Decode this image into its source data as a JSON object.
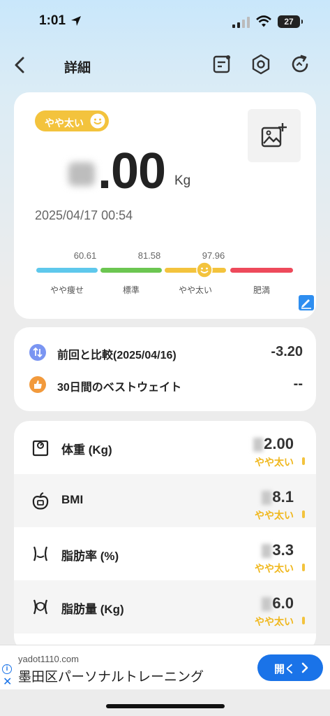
{
  "status_bar": {
    "time": "1:01",
    "battery": "27"
  },
  "nav": {
    "title": "詳細"
  },
  "summary": {
    "badge": "やや太い",
    "weight_value": ".00",
    "unit": "Kg",
    "measured_at": "2025/04/17 00:54",
    "thresholds": [
      "60.61",
      "81.58",
      "97.96"
    ],
    "categories": [
      {
        "label": "やや痩せ",
        "color": "#5ec8ec"
      },
      {
        "label": "標準",
        "color": "#6cc651"
      },
      {
        "label": "やや太い",
        "color": "#f3c33d"
      },
      {
        "label": "肥満",
        "color": "#ee4a5b"
      }
    ]
  },
  "compare": {
    "previous_label": "前回と比較(2025/04/16)",
    "previous_value": "-3.20",
    "best_label": "30日間のベストウェイト",
    "best_value": "--"
  },
  "metrics": [
    {
      "label": "体重 (Kg)",
      "value": "2.00",
      "status": "やや太い"
    },
    {
      "label": "BMI",
      "value": "8.1",
      "status": "やや太い"
    },
    {
      "label": "脂肪率 (%)",
      "value": "3.3",
      "status": "やや太い"
    },
    {
      "label": "脂肪量 (Kg)",
      "value": "6.0",
      "status": "やや太い"
    }
  ],
  "ad": {
    "domain": "yadot1110.com",
    "title": "墨田区パーソナルトレーニング",
    "button": "開く"
  },
  "colors": {
    "accent": "#f3c33d",
    "link": "#1a73e8"
  }
}
